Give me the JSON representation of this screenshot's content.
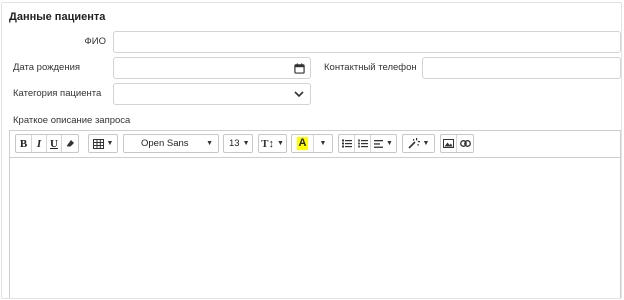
{
  "section": {
    "title": "Данные пациента"
  },
  "form": {
    "fio_label": "ФИО",
    "birth_label": "Дата рождения",
    "phone_label": "Контактный телефон",
    "category_label": "Категория пациента",
    "description_label": "Краткое описание запроса",
    "fio_value": "",
    "birth_value": "",
    "phone_value": "",
    "category_value": ""
  },
  "toolbar": {
    "bold": "B",
    "italic": "I",
    "underline": "U",
    "font_family": "Open Sans",
    "font_size": "13",
    "text_size_glyph": "T↕",
    "color_glyph": "A"
  },
  "icons": {
    "calendar": "calendar-icon",
    "chevron": "chevron-down-icon",
    "eraser": "eraser-icon",
    "table": "table-icon",
    "ul": "unordered-list-icon",
    "ol": "ordered-list-icon",
    "align": "align-icon",
    "magic": "magic-wand-icon",
    "image": "image-icon",
    "link": "link-icon"
  },
  "colors": {
    "highlight": "#ffff00",
    "border": "#d3d3d3"
  }
}
